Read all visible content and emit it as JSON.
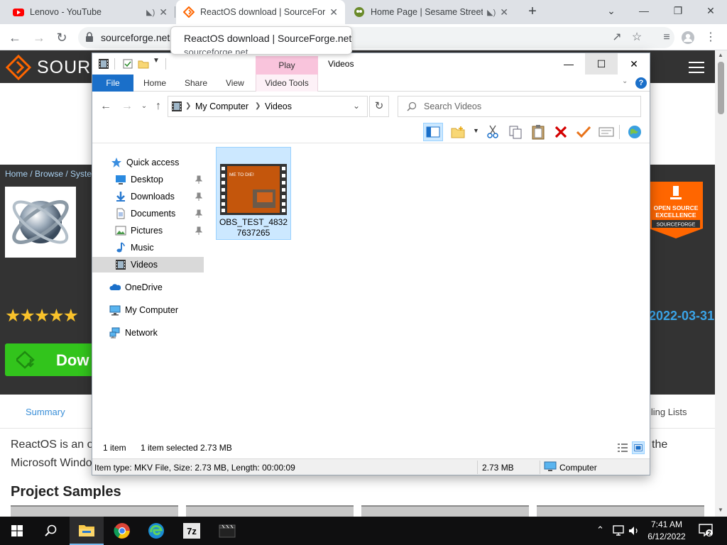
{
  "browser": {
    "tabs": [
      {
        "title": "Lenovo - YouTube",
        "favicon": "youtube-icon"
      },
      {
        "title": "ReactOS download | SourceForge.net",
        "favicon": "sourceforge-icon"
      },
      {
        "title": "Home Page | Sesame Street",
        "favicon": "sesame-street-icon"
      }
    ],
    "url": "sourceforge.net",
    "tooltip_title": "ReactOS download | SourceForge.net",
    "tooltip_url": "sourceforge.net"
  },
  "sourceforge": {
    "logo_text": "SOURC",
    "breadcrumb": "Home / Browse / Syster",
    "download_label": "Dow",
    "date": "2022-03-31",
    "tab_summary": "Summary",
    "tab_mailing": "iling Lists",
    "desc_line1": "ReactOS is an op",
    "desc_line2": "Microsoft Windo",
    "desc_right": "the",
    "samples_heading": "Project Samples",
    "badge_line1": "OPEN SOURCE",
    "badge_line2": "EXCELLENCE",
    "badge_line3": "SOURCEFORGE",
    "rating": 4.5,
    "accent": "#ff6600"
  },
  "explorer": {
    "window_title": "Videos",
    "play_tab": "Play",
    "ribbon_tabs": [
      "File",
      "Home",
      "Share",
      "View",
      "Video Tools"
    ],
    "address": {
      "root": "My Computer",
      "folder": "Videos"
    },
    "search_placeholder": "Search Videos",
    "nav": {
      "quick_access": "Quick access",
      "desktop": "Desktop",
      "downloads": "Downloads",
      "documents": "Documents",
      "pictures": "Pictures",
      "music": "Music",
      "videos": "Videos",
      "onedrive": "OneDrive",
      "my_computer": "My Computer",
      "network": "Network"
    },
    "file": {
      "name": "OBS_TEST_48327637265",
      "thumb_text": "ME TO DIE!"
    },
    "status": {
      "count": "1 item",
      "selected": "1 item selected  2.73 MB"
    },
    "details": {
      "info": "Item type: MKV File, Size: 2.73 MB, Length: 00:00:09",
      "size": "2.73 MB",
      "location": "Computer"
    }
  },
  "taskbar": {
    "time": "7:41 AM",
    "date": "6/12/2022",
    "notifications": "2"
  }
}
